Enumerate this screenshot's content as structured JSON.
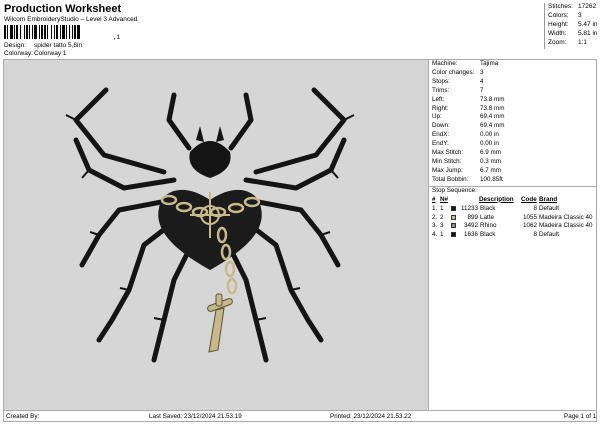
{
  "header": {
    "title": "Production Worksheet",
    "subtitle": "Wilcom EmbroideryStudio – Level 3 Advanced",
    "barcode_mark": ",1",
    "design_label": "Design:",
    "design_value": "spider tatto 5,8in",
    "colorway_label": "Colorway:",
    "colorway_value": "Colorway 1"
  },
  "stats": [
    {
      "label": "Stitches:",
      "value": "17262"
    },
    {
      "label": "Colors:",
      "value": "3"
    },
    {
      "label": "Height:",
      "value": "5.47 in"
    },
    {
      "label": "Width:",
      "value": "5.81 in"
    },
    {
      "label": "Zoom:",
      "value": "1:1"
    }
  ],
  "machine": [
    {
      "label": "Machine:",
      "value": "Tajima"
    },
    {
      "label": "Color changes:",
      "value": "3"
    },
    {
      "label": "Stops:",
      "value": "4"
    },
    {
      "label": "Trims:",
      "value": "7"
    },
    {
      "label": "Left:",
      "value": "73.8 mm"
    },
    {
      "label": "Right:",
      "value": "73.8 mm"
    },
    {
      "label": "Up:",
      "value": "69.4 mm"
    },
    {
      "label": "Down:",
      "value": "69.4 mm"
    },
    {
      "label": "EndX:",
      "value": "0.00 in"
    },
    {
      "label": "EndY:",
      "value": "0.00 in"
    },
    {
      "label": "Max Stitch:",
      "value": "6.9 mm"
    },
    {
      "label": "Min Stitch:",
      "value": "0.3 mm"
    },
    {
      "label": "Max Jump:",
      "value": "6.7 mm"
    },
    {
      "label": "Total Bobbin:",
      "value": "100.85ft"
    }
  ],
  "stop_sequence": {
    "title": "Stop Sequence:",
    "headers": {
      "num": "#",
      "n": "N#",
      "description": "Description",
      "code": "Code",
      "brand": "Brand"
    },
    "rows": [
      {
        "num": "1.",
        "n": "1",
        "stitches": "11233",
        "color": "#111111",
        "description": "Black",
        "code": "8",
        "brand": "Default"
      },
      {
        "num": "2.",
        "n": "2",
        "stitches": "899",
        "color": "#c9b98a",
        "description": "Latte",
        "code": "1055",
        "brand": "Madeira Classic 40"
      },
      {
        "num": "3.",
        "n": "3",
        "stitches": "3492",
        "color": "#8a8a8a",
        "description": "Rhino",
        "code": "1062",
        "brand": "Madeira Classic 40"
      },
      {
        "num": "4.",
        "n": "1",
        "stitches": "1636",
        "color": "#111111",
        "description": "Black",
        "code": "8",
        "brand": "Default"
      }
    ]
  },
  "footer": {
    "created_by": "Created By:",
    "last_saved": "Last Saved: 23/12/2024 21.53.19",
    "printed": "Printed: 23/12/2024 21.53.22",
    "page": "Page 1 of 1"
  },
  "colors": {
    "canvas": "#d6d6d6",
    "thread_black": "#111111",
    "thread_latte": "#c9b98a",
    "thread_rhino": "#8a8a8a"
  }
}
